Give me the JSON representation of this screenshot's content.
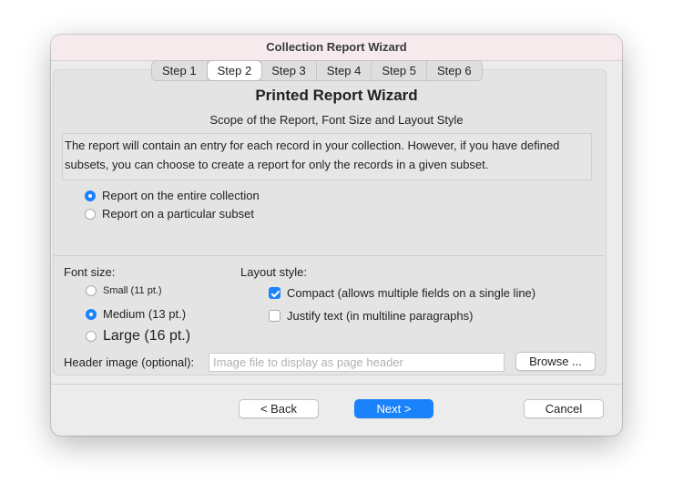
{
  "window": {
    "title": "Collection Report Wizard"
  },
  "tabs": [
    "Step 1",
    "Step 2",
    "Step 3",
    "Step 4",
    "Step 5",
    "Step 6"
  ],
  "active_tab": "Step 2",
  "wizard": {
    "title": "Printed Report Wizard",
    "subtitle": "Scope of the Report, Font Size and Layout Style",
    "description": "The report will contain an entry for each record in your collection.  However, if you have defined subsets, you can choose to create a report for only the records in a given subset."
  },
  "scope_options": [
    {
      "label": "Report on the entire collection",
      "selected": true
    },
    {
      "label": "Report on a particular subset",
      "selected": false
    }
  ],
  "font_size": {
    "label": "Font size:",
    "options": [
      {
        "label": "Small (11 pt.)",
        "selected": false
      },
      {
        "label": "Medium (13 pt.)",
        "selected": true
      },
      {
        "label": "Large (16 pt.)",
        "selected": false
      }
    ]
  },
  "layout_style": {
    "label": "Layout style:",
    "options": [
      {
        "label": "Compact (allows multiple fields on a single line)",
        "checked": true
      },
      {
        "label": "Justify text (in multiline paragraphs)",
        "checked": false
      }
    ]
  },
  "header_image": {
    "label": "Header image (optional):",
    "value": "",
    "placeholder": "Image file to display as page header",
    "browse_label": "Browse ..."
  },
  "buttons": {
    "back": "< Back",
    "next": "Next >",
    "cancel": "Cancel"
  },
  "colors": {
    "accent": "#1a82fb",
    "window_bg": "#ececec",
    "panel_bg": "#e4e4e4",
    "titlebar_bg": "#f6eaec"
  }
}
